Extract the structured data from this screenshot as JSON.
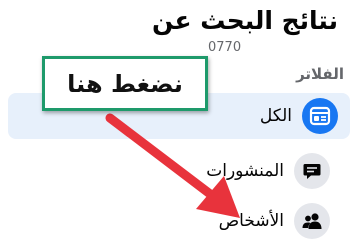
{
  "header": {
    "title": "نتائج البحث عن",
    "query": "0770"
  },
  "filters": {
    "heading": "الفلاتر",
    "items": [
      {
        "label": "الكل",
        "icon": "feed-icon",
        "active": true
      },
      {
        "label": "المنشورات",
        "icon": "post-icon",
        "active": false
      },
      {
        "label": "الأشخاص",
        "icon": "people-icon",
        "active": false
      }
    ]
  },
  "annotation": {
    "text": "نضغط هنا",
    "border_color": "#1e9a6b",
    "arrow_color": "#e8333c"
  },
  "colors": {
    "accent": "#1877f2",
    "active_bg": "#e7f0fb",
    "icon_bg": "#e4e6eb"
  }
}
